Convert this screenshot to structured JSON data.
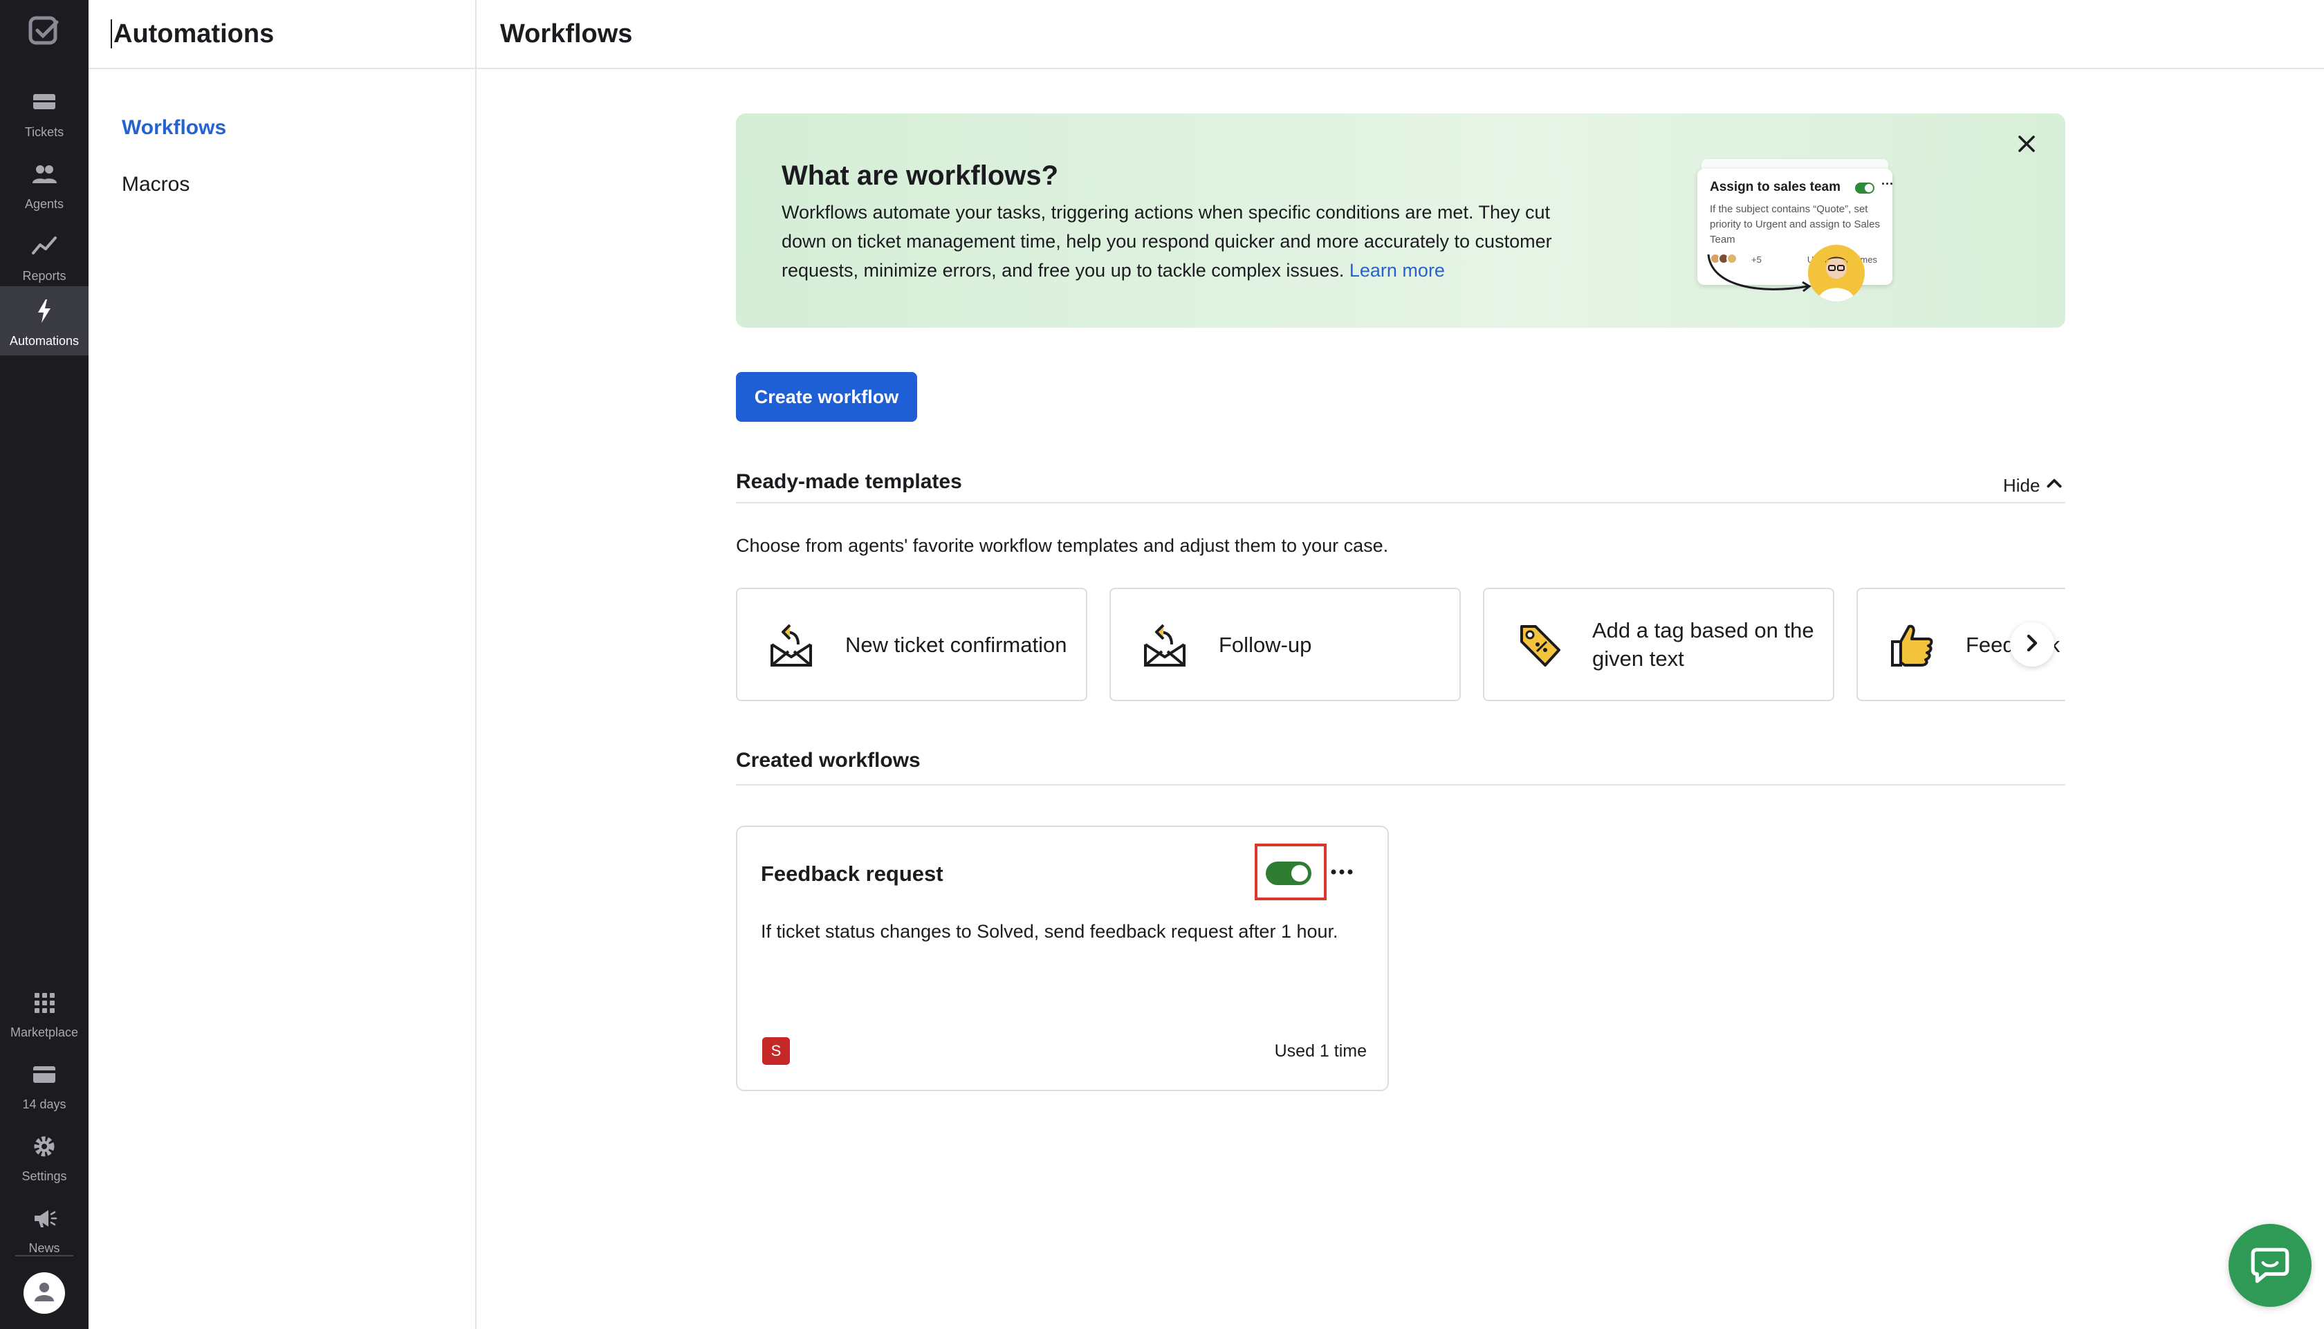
{
  "rail": {
    "items": [
      {
        "label": "Tickets",
        "icon": "ticket-icon"
      },
      {
        "label": "Agents",
        "icon": "agents-icon"
      },
      {
        "label": "Reports",
        "icon": "reports-icon"
      },
      {
        "label": "Automations",
        "icon": "lightning-icon",
        "active": true
      }
    ],
    "bottom_items": [
      {
        "label": "Marketplace",
        "icon": "grid-icon"
      },
      {
        "label": "14 days",
        "icon": "card-icon"
      },
      {
        "label": "Settings",
        "icon": "gear-icon"
      },
      {
        "label": "News",
        "icon": "megaphone-icon"
      }
    ]
  },
  "subnav": {
    "title": "Automations",
    "items": [
      {
        "label": "Workflows",
        "active": true
      },
      {
        "label": "Macros"
      }
    ]
  },
  "header": {
    "title": "Workflows"
  },
  "banner": {
    "title": "What are workflows?",
    "text": "Workflows automate your tasks, triggering actions when specific conditions are met. They cut down on ticket management time, help you respond quicker and more accurately to customer requests, minimize errors, and free you up to tackle complex issues.",
    "link": "Learn more",
    "preview": {
      "title": "Assign to sales team",
      "text": "If the subject contains “Quote”, set priority to Urgent and assign to Sales Team",
      "count": "+5",
      "used": "Used 2,563 times"
    }
  },
  "create_button": "Create workflow",
  "templates": {
    "title": "Ready-made templates",
    "hide_label": "Hide",
    "description": "Choose from agents' favorite workflow templates and adjust them to your case.",
    "items": [
      {
        "label": "New ticket confirmation",
        "icon": "envelope-reply-icon"
      },
      {
        "label": "Follow-up",
        "icon": "envelope-reply-icon"
      },
      {
        "label": "Add a tag based on the given text",
        "icon": "tag-icon"
      },
      {
        "label": "Feedback request",
        "icon": "thumbs-up-icon"
      }
    ]
  },
  "created": {
    "title": "Created workflows",
    "workflows": [
      {
        "title": "Feedback request",
        "description": "If ticket status changes to Solved, send feedback request after 1 hour.",
        "badge": "S",
        "used": "Used 1 time",
        "enabled": true
      }
    ]
  },
  "colors": {
    "accent": "#1f5fd6",
    "toggle_on": "#2e7d32",
    "highlight_frame": "#d9382d",
    "chat": "#2e9a56"
  }
}
